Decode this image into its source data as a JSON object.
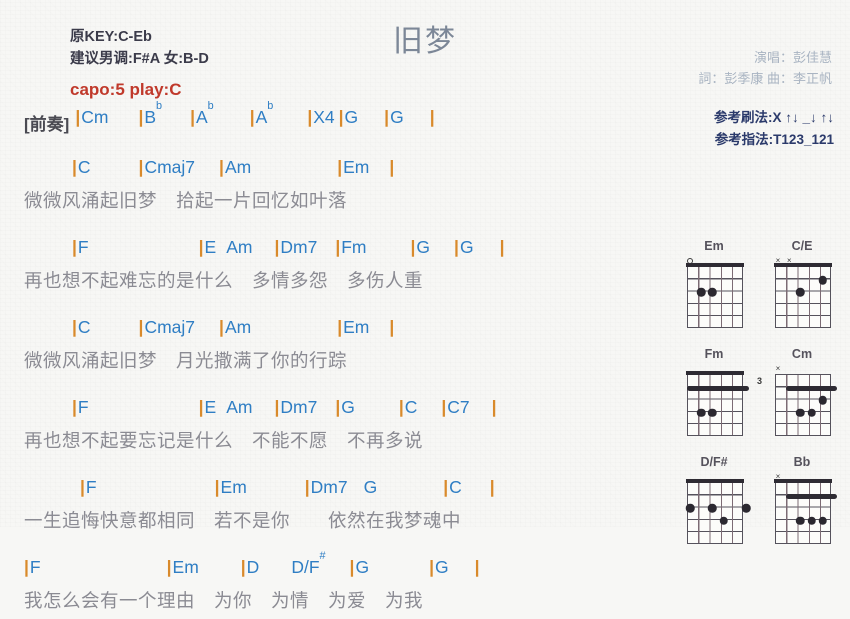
{
  "header": {
    "title": "旧梦",
    "meta": [
      "原KEY:C-Eb",
      "建议男调:F#A 女:B-D"
    ],
    "capo": "capo:5 play:C",
    "credits": [
      "演唱：彭佳慧",
      "詞：彭季康  曲：李正帆"
    ],
    "play_notes": [
      "参考刷法:X ↑↓ _↓ ↑↓",
      "参考指法:T123_121"
    ],
    "colors": {
      "title": "#7c8797",
      "capo": "#c0392b",
      "chord": "#2f7ec4",
      "bar": "#d98a2b",
      "lyric": "#8b8b93",
      "credits": "#a9b4c2",
      "play_notes": "#2b3a6b"
    }
  },
  "intro": {
    "tag": "[前奏]",
    "chords": [
      {
        "bar": "|",
        "name": "Cm",
        "sup": "",
        "pad": 30
      },
      {
        "bar": "|",
        "name": "B",
        "sup": "b",
        "pad": 28
      },
      {
        "bar": "|",
        "name": "A",
        "sup": "b",
        "pad": 36
      },
      {
        "bar": "|",
        "name": "A",
        "sup": "b",
        "pad": 34
      },
      {
        "bar": "|",
        "name": "X4",
        "sup": "",
        "pad": 4
      },
      {
        "bar": "|",
        "name": "G",
        "sup": "",
        "pad": 26
      },
      {
        "bar": "|",
        "name": "G",
        "sup": "",
        "pad": 26
      },
      {
        "bar": "|",
        "name": "",
        "sup": "",
        "pad": 0
      }
    ]
  },
  "blocks": [
    {
      "indent": 72,
      "chords": [
        {
          "bar": "|",
          "name": "C",
          "sup": "",
          "pad": 48
        },
        {
          "bar": "|",
          "name": "Cmaj7",
          "sup": "",
          "pad": 24
        },
        {
          "bar": "|",
          "name": "Am",
          "sup": "",
          "pad": 86
        },
        {
          "bar": "|",
          "name": "Em",
          "sup": "",
          "pad": 20
        },
        {
          "bar": "|",
          "name": "",
          "sup": "",
          "pad": 0
        }
      ],
      "lyric": "微微风涌起旧梦　拾起一片回忆如叶落"
    },
    {
      "indent": 72,
      "chords": [
        {
          "bar": "|",
          "name": "F",
          "sup": "",
          "pad": 110
        },
        {
          "bar": "|",
          "name": "E",
          "sup": "",
          "pad": 10
        },
        {
          "bar": "",
          "name": "Am",
          "sup": "",
          "pad": 22
        },
        {
          "bar": "|",
          "name": "Dm7",
          "sup": "",
          "pad": 18
        },
        {
          "bar": "|",
          "name": "Fm",
          "sup": "",
          "pad": 44
        },
        {
          "bar": "|",
          "name": "G",
          "sup": "",
          "pad": 24
        },
        {
          "bar": "|",
          "name": "G",
          "sup": "",
          "pad": 26
        },
        {
          "bar": "|",
          "name": "",
          "sup": "",
          "pad": 0
        }
      ],
      "lyric": "再也想不起难忘的是什么　多情多怨　多伤人重"
    },
    {
      "indent": 72,
      "chords": [
        {
          "bar": "|",
          "name": "C",
          "sup": "",
          "pad": 48
        },
        {
          "bar": "|",
          "name": "Cmaj7",
          "sup": "",
          "pad": 24
        },
        {
          "bar": "|",
          "name": "Am",
          "sup": "",
          "pad": 86
        },
        {
          "bar": "|",
          "name": "Em",
          "sup": "",
          "pad": 20
        },
        {
          "bar": "|",
          "name": "",
          "sup": "",
          "pad": 0
        }
      ],
      "lyric": "微微风涌起旧梦　月光撒满了你的行踪"
    },
    {
      "indent": 72,
      "chords": [
        {
          "bar": "|",
          "name": "F",
          "sup": "",
          "pad": 110
        },
        {
          "bar": "|",
          "name": "E",
          "sup": "",
          "pad": 10
        },
        {
          "bar": "",
          "name": "Am",
          "sup": "",
          "pad": 22
        },
        {
          "bar": "|",
          "name": "Dm7",
          "sup": "",
          "pad": 18
        },
        {
          "bar": "|",
          "name": "G",
          "sup": "",
          "pad": 44
        },
        {
          "bar": "|",
          "name": "C",
          "sup": "",
          "pad": 24
        },
        {
          "bar": "|",
          "name": "C7",
          "sup": "",
          "pad": 22
        },
        {
          "bar": "|",
          "name": "",
          "sup": "",
          "pad": 0
        }
      ],
      "lyric": "再也想不起要忘记是什么　不能不愿　不再多说"
    },
    {
      "indent": 80,
      "chords": [
        {
          "bar": "|",
          "name": "F",
          "sup": "",
          "pad": 118
        },
        {
          "bar": "|",
          "name": "Em",
          "sup": "",
          "pad": 58
        },
        {
          "bar": "|",
          "name": "Dm7",
          "sup": "",
          "pad": 16
        },
        {
          "bar": "",
          "name": "G",
          "sup": "",
          "pad": 66
        },
        {
          "bar": "|",
          "name": "C",
          "sup": "",
          "pad": 28
        },
        {
          "bar": "|",
          "name": "",
          "sup": "",
          "pad": 0
        }
      ],
      "lyric": "一生追悔快意都相同　若不是你　　依然在我梦魂中"
    },
    {
      "indent": 24,
      "chords": [
        {
          "bar": "|",
          "name": "F",
          "sup": "",
          "pad": 126
        },
        {
          "bar": "|",
          "name": "Em",
          "sup": "",
          "pad": 42
        },
        {
          "bar": "|",
          "name": "D",
          "sup": "",
          "pad": 32
        },
        {
          "bar": "",
          "name": "D/F",
          "sup": "#",
          "pad": 24
        },
        {
          "bar": "|",
          "name": "G",
          "sup": "",
          "pad": 60
        },
        {
          "bar": "|",
          "name": "G",
          "sup": "",
          "pad": 26
        },
        {
          "bar": "|",
          "name": "",
          "sup": "",
          "pad": 0
        }
      ],
      "lyric": "我怎么会有一个理由　为你　为情　为爱　为我"
    }
  ],
  "diagrams": [
    {
      "name": "Em",
      "start_fret": "",
      "markers": [
        {
          "string": 1,
          "type": "open"
        }
      ],
      "barre": null,
      "dots": [
        {
          "string": 2,
          "fret": 2
        },
        {
          "string": 3,
          "fret": 2
        }
      ]
    },
    {
      "name": "C/E",
      "start_fret": "",
      "markers": [
        {
          "string": 1,
          "type": "mute"
        },
        {
          "string": 2,
          "type": "mute"
        }
      ],
      "barre": null,
      "dots": [
        {
          "string": 3,
          "fret": 2
        },
        {
          "string": 5,
          "fret": 1
        }
      ]
    },
    {
      "name": "Fm",
      "start_fret": "",
      "markers": [],
      "barre": {
        "fret": 1,
        "from": 1,
        "to": 6
      },
      "dots": [
        {
          "string": 2,
          "fret": 3
        },
        {
          "string": 3,
          "fret": 3
        }
      ]
    },
    {
      "name": "Cm",
      "start_fret": "3",
      "markers": [
        {
          "string": 1,
          "type": "mute"
        }
      ],
      "barre": {
        "fret": 1,
        "from": 2,
        "to": 6
      },
      "dots": [
        {
          "string": 3,
          "fret": 3
        },
        {
          "string": 4,
          "fret": 3
        },
        {
          "string": 5,
          "fret": 2
        }
      ]
    },
    {
      "name": "D/F#",
      "start_fret": "",
      "markers": [],
      "barre": null,
      "dots": [
        {
          "string": 1,
          "fret": 2
        },
        {
          "string": 3,
          "fret": 2
        },
        {
          "string": 4,
          "fret": 3
        },
        {
          "string": 6,
          "fret": 2
        }
      ]
    },
    {
      "name": "Bb",
      "start_fret": "",
      "markers": [
        {
          "string": 1,
          "type": "mute"
        }
      ],
      "barre": {
        "fret": 1,
        "from": 2,
        "to": 6
      },
      "dots": [
        {
          "string": 3,
          "fret": 3
        },
        {
          "string": 4,
          "fret": 3
        },
        {
          "string": 5,
          "fret": 3
        }
      ]
    }
  ]
}
